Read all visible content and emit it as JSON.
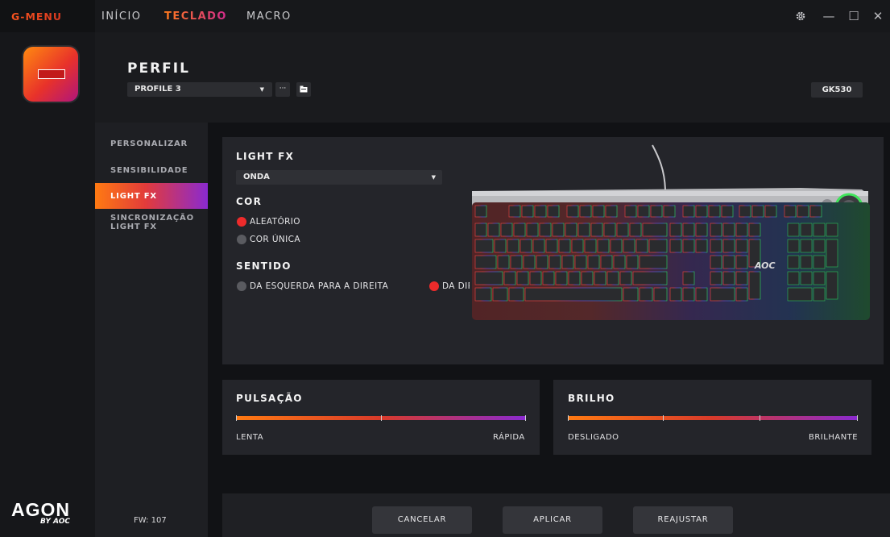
{
  "app": {
    "brand": "G-MENU"
  },
  "nav": {
    "inicio": "INÍCIO",
    "teclado": "TECLADO",
    "macro": "MACRO"
  },
  "window": {
    "settings_icon": "gear-icon",
    "minimize": "—",
    "maximize": "☐",
    "close": "✕"
  },
  "profile": {
    "title": "PERFIL",
    "selected": "PROFILE 3",
    "more_label": "···",
    "model": "GK530"
  },
  "sidebar": {
    "items": [
      {
        "label": "PERSONALIZAR"
      },
      {
        "label": "SENSIBILIDADE"
      },
      {
        "label": "LIGHT FX"
      },
      {
        "label": "SINCRONIZAÇÃO\nLIGHT FX"
      }
    ],
    "active_index": 2,
    "firmware": "FW: 107"
  },
  "lightfx": {
    "title": "LIGHT FX",
    "effect": "ONDA",
    "cor_title": "COR",
    "cor_options": [
      "ALEATÓRIO",
      "COR ÚNICA"
    ],
    "cor_selected": 0,
    "sentido_title": "SENTIDO",
    "sentido_options": [
      "DA ESQUERDA PARA A DIREITA",
      "DA DIR"
    ],
    "sentido_selected": 1
  },
  "pulsacao": {
    "title": "PULSAÇÃO",
    "min_label": "LENTA",
    "max_label": "RÁPIDA",
    "value": 0.5
  },
  "brilho": {
    "title": "BRILHO",
    "min_label": "DESLIGADO",
    "max_label": "BRILHANTE",
    "value": 0.33
  },
  "footer": {
    "cancel": "CANCELAR",
    "apply": "APLICAR",
    "reset": "REAJUSTAR"
  },
  "logo": {
    "main": "AGON",
    "sub": "BY AOC",
    "keyboard_logo": "AOC"
  },
  "colors": {
    "accent_orange": "#ff7a12",
    "accent_red": "#e23b3b",
    "accent_purple": "#8a2ad0",
    "radio_on": "#ee2b2b"
  }
}
